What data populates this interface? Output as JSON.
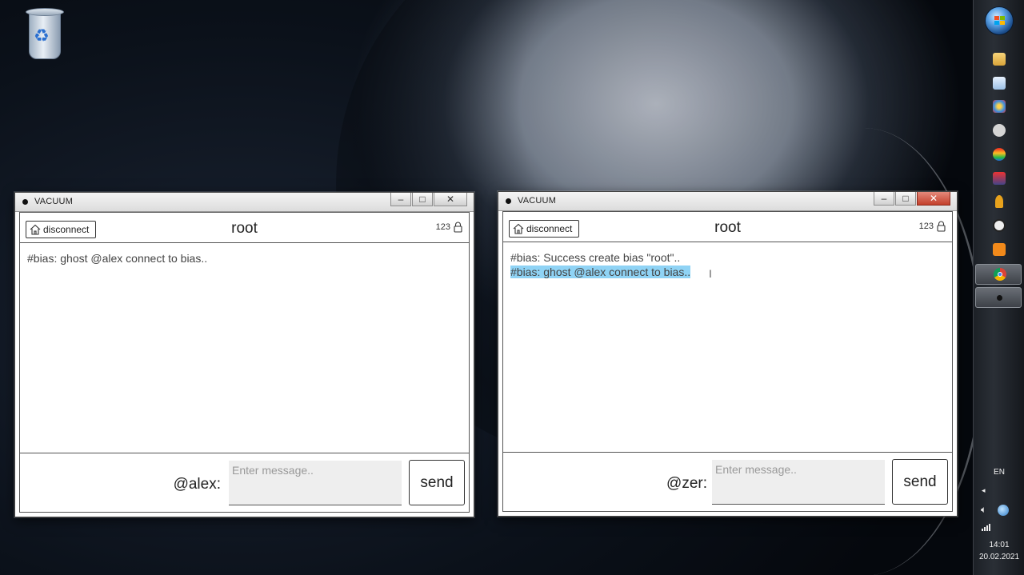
{
  "desktop": {
    "recycle_bin_icon": "recycle-bin-icon"
  },
  "windows": [
    {
      "title": "VACUUM",
      "disconnect_label": "disconnect",
      "room": "root",
      "count": "123",
      "messages": [
        "#bias: ghost @alex connect to bias.."
      ],
      "nick": "@alex:",
      "input_placeholder": "Enter message..",
      "send_label": "send",
      "controls": {
        "minimize": "–",
        "maximize": "□",
        "close": "✕"
      }
    },
    {
      "title": "VACUUM",
      "disconnect_label": "disconnect",
      "room": "root",
      "count": "123",
      "messages": [
        "#bias: Success create bias \"root\"..",
        "#bias: ghost @alex connect to bias.."
      ],
      "nick": "@zer:",
      "input_placeholder": "Enter message..",
      "send_label": "send",
      "controls": {
        "minimize": "–",
        "maximize": "□",
        "close": "✕"
      }
    }
  ],
  "taskbar": {
    "language": "EN",
    "time": "14:01",
    "date": "20.02.2021",
    "colors": {
      "selection": "#8fd3f5",
      "close_active": "#c3402c"
    }
  }
}
